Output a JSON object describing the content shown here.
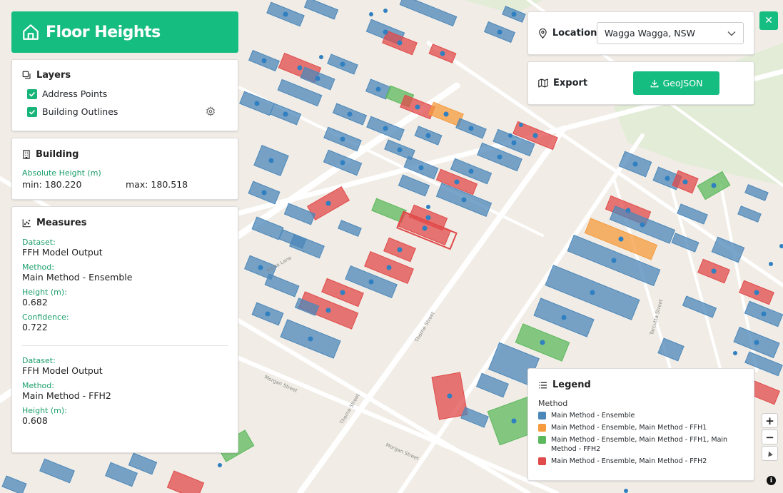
{
  "header": {
    "title": "Floor Heights",
    "color": "#16bd80"
  },
  "close": {
    "icon": "close-icon",
    "label": "✕"
  },
  "layers": {
    "title": "Layers",
    "items": [
      {
        "label": "Address Points",
        "checked": true
      },
      {
        "label": "Building Outlines",
        "checked": true
      }
    ]
  },
  "building": {
    "title": "Building",
    "abs_height_label": "Absolute Height (m)",
    "min": "min: 180.220",
    "max": "max: 180.518"
  },
  "measures": {
    "title": "Measures",
    "entries": [
      {
        "dataset_label": "Dataset:",
        "dataset": "FFH Model Output",
        "method_label": "Method:",
        "method": "Main Method - Ensemble",
        "height_label": "Height (m):",
        "height": "0.682",
        "confidence_label": "Confidence:",
        "confidence": "0.722"
      },
      {
        "dataset_label": "Dataset:",
        "dataset": "FFH Model Output",
        "method_label": "Method:",
        "method": "Main Method - FFH2",
        "height_label": "Height (m):",
        "height": "0.608"
      }
    ]
  },
  "location": {
    "label": "Location",
    "value": "Wagga Wagga, NSW"
  },
  "export": {
    "label": "Export",
    "button": "GeoJSON"
  },
  "legend": {
    "title": "Legend",
    "subtitle": "Method",
    "items": [
      {
        "label": "Main Method - Ensemble",
        "color": "#4c87b9"
      },
      {
        "label": "Main Method - Ensemble, Main Method - FFH1",
        "color": "#f59b3d"
      },
      {
        "label": "Main Method - Ensemble, Main Method - FFH1, Main Method - FFH2",
        "color": "#5cb85c"
      },
      {
        "label": "Main Method - Ensemble, Main Method - FFH2",
        "color": "#e04a4a"
      }
    ]
  },
  "map_streets": [
    "Alpha Lane",
    "Morgan Street",
    "Thorne Street",
    "Tarcutta Street",
    "Morgan Street",
    "Thorne Street"
  ],
  "map_controls": {
    "zoom_in": "+",
    "zoom_out": "−",
    "compass": "▲",
    "info": "i"
  }
}
